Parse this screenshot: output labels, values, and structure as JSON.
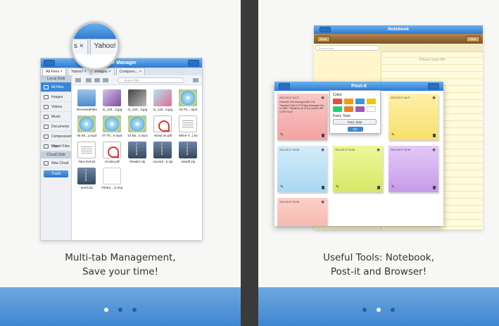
{
  "panels": {
    "left": {
      "caption_line1": "Multi-tab Management,",
      "caption_line2": "Save your time!"
    },
    "right": {
      "caption_line1": "Useful Tools: Notebook,",
      "caption_line2": "Post-it and Browser!"
    }
  },
  "file_manager": {
    "title": "File Manager",
    "title_partial": "sk    le Manager",
    "tabs": [
      "All Files ×",
      "Yahoo! ×",
      "Images ×",
      "Compres... ×"
    ],
    "magnifier_tabs": [
      "s ×",
      "Yahoo!"
    ],
    "search_placeholder": "Search file",
    "sidebar": {
      "local_header": "Local Disk",
      "items": [
        "All Files",
        "Images",
        "Videos",
        "Music",
        "Documents",
        "Compressed Files",
        "Import Files"
      ],
      "cloud_header": "Cloud Disk",
      "new_cloud": "New Cloud",
      "trash": "Trash"
    },
    "files": [
      {
        "name": "ReceivedFiles",
        "icon": "folder"
      },
      {
        "name": "m_134...3.jpg",
        "icon": "image-purple"
      },
      {
        "name": "m_134...3.jpg",
        "icon": "image-gray"
      },
      {
        "name": "m_134...6.jpg",
        "icon": "image-teal"
      },
      {
        "name": "03 Pu....mp3",
        "icon": "music-cd"
      },
      {
        "name": "05 Eh...y.mp3",
        "icon": "music-cd"
      },
      {
        "name": "07 Th...e.mp3",
        "icon": "music-cd"
      },
      {
        "name": "10 Bo...s.mp3",
        "icon": "music-cd"
      },
      {
        "name": "About us.pdf",
        "icon": "pdf"
      },
      {
        "name": "Mime-T...).txt",
        "icon": "text"
      },
      {
        "name": "New text.txt",
        "icon": "text"
      },
      {
        "name": "Xcode.pdf",
        "icon": "pdf"
      },
      {
        "name": "Reader.zip",
        "icon": "zip"
      },
      {
        "name": "cocos2...2.zip",
        "icon": "zip"
      },
      {
        "name": "swwift.zip",
        "icon": "zip"
      },
      {
        "name": "word.zip",
        "icon": "zip"
      },
      {
        "name": "FileEx....S.tmp",
        "icon": "blank"
      }
    ]
  },
  "notebook": {
    "title": "Notebook",
    "new_label": "New",
    "save_label": "Save",
    "search_placeholder": "Search here",
    "input_placeholder": "Please input title"
  },
  "postit": {
    "title": "Post-it",
    "popup": {
      "color_label": "Color",
      "font_size_label": "Font, Size",
      "font_size_button": "Font, Size",
      "ok": "OK",
      "swatches": [
        "#e74c3c",
        "#f39c12",
        "#3498db",
        "#f1c40f",
        "#2ecc71",
        "#e67e22",
        "#9b59b6",
        "#ffffff"
      ]
    },
    "notes": [
      {
        "timestamp": "2012.09.27 04:27",
        "body": "Powerful File Manager/WiFi File Transfer/ Web & FTP/App Manager/ ALL in ONE. Thanks to all of our users!! WE LOVE You!!",
        "color": "red"
      },
      {
        "timestamp": "2012.09.27 04:27",
        "body": "",
        "color": "yellow"
      },
      {
        "timestamp": "2012.09.27 04:38",
        "body": "",
        "color": "blue"
      },
      {
        "timestamp": "2012.09.27 04:38",
        "body": "",
        "color": "green"
      },
      {
        "timestamp": "2012.09.27 04:38",
        "body": "",
        "color": "purple"
      },
      {
        "timestamp": "2012.09.27 04:38",
        "body": "",
        "color": "pink"
      }
    ]
  },
  "pager": {
    "left_active": 0,
    "right_active": 1,
    "count": 3
  }
}
